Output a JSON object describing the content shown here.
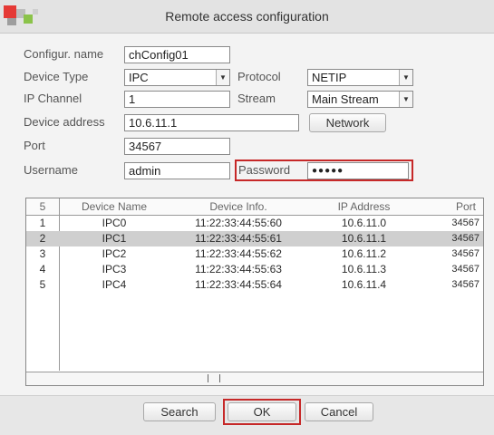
{
  "window": {
    "title": "Remote access configuration"
  },
  "colors": {
    "highlight_border": "#c62828",
    "selected_row": "#cfcfcf"
  },
  "form": {
    "config_name_label": "Configur. name",
    "config_name_value": "chConfig01",
    "device_type_label": "Device Type",
    "device_type_value": "IPC",
    "protocol_label": "Protocol",
    "protocol_value": "NETIP",
    "ip_channel_label": "IP Channel",
    "ip_channel_value": "1",
    "stream_label": "Stream",
    "stream_value": "Main Stream",
    "device_address_label": "Device address",
    "device_address_value": "10.6.11.1",
    "network_button": "Network",
    "port_label": "Port",
    "port_value": "34567",
    "username_label": "Username",
    "username_value": "admin",
    "password_label": "Password",
    "password_value": "●●●●●"
  },
  "table": {
    "headers": [
      "5",
      "Device Name",
      "Device Info.",
      "IP Address",
      "Port"
    ],
    "rows": [
      {
        "num": "1",
        "name": "IPC0",
        "info": "11:22:33:44:55:60",
        "ip": "10.6.11.0",
        "port": "34567",
        "selected": false
      },
      {
        "num": "2",
        "name": "IPC1",
        "info": "11:22:33:44:55:61",
        "ip": "10.6.11.1",
        "port": "34567",
        "selected": true
      },
      {
        "num": "3",
        "name": "IPC2",
        "info": "11:22:33:44:55:62",
        "ip": "10.6.11.2",
        "port": "34567",
        "selected": false
      },
      {
        "num": "4",
        "name": "IPC3",
        "info": "11:22:33:44:55:63",
        "ip": "10.6.11.3",
        "port": "34567",
        "selected": false
      },
      {
        "num": "5",
        "name": "IPC4",
        "info": "11:22:33:44:55:64",
        "ip": "10.6.11.4",
        "port": "34567",
        "selected": false
      }
    ]
  },
  "buttons": {
    "search": "Search",
    "ok": "OK",
    "cancel": "Cancel"
  }
}
